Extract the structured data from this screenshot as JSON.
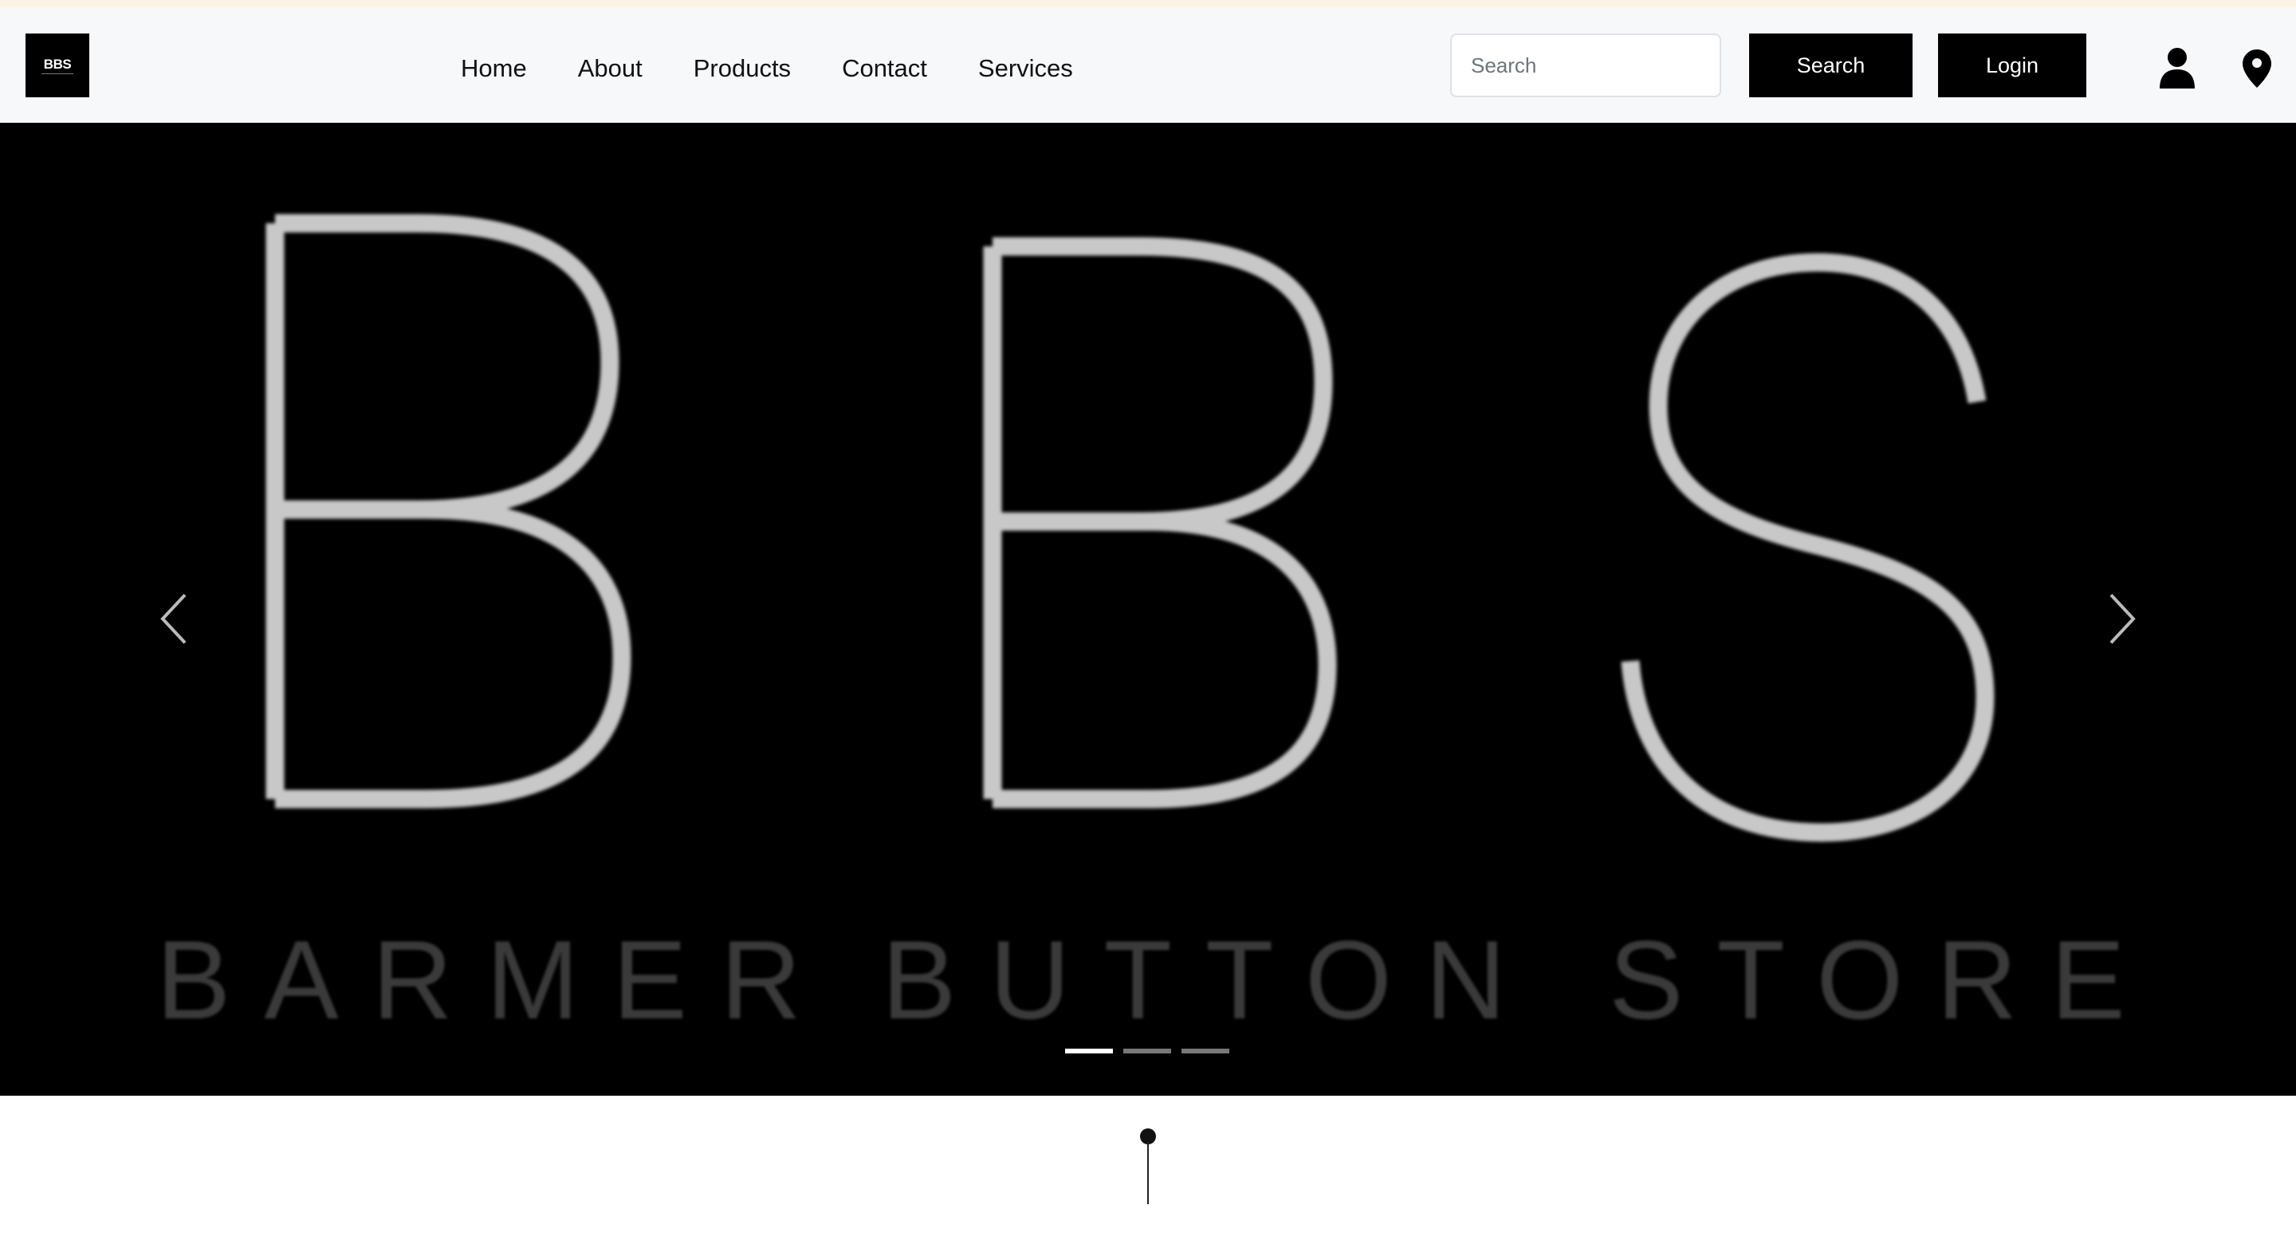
{
  "brand": {
    "logo_text": "BBS"
  },
  "nav": {
    "links": [
      {
        "label": "Home"
      },
      {
        "label": "About"
      },
      {
        "label": "Products"
      },
      {
        "label": "Contact"
      },
      {
        "label": "Services"
      }
    ]
  },
  "search": {
    "placeholder": "Search",
    "value": "",
    "button_label": "Search"
  },
  "auth": {
    "login_label": "Login"
  },
  "icons": {
    "user": "user-icon",
    "location": "map-pin-icon",
    "prev": "chevron-left-icon",
    "next": "chevron-right-icon"
  },
  "hero": {
    "logo_letters": "BBS",
    "words": [
      "BARMER",
      "BUTTON",
      "STORE"
    ],
    "active_slide": 1,
    "slide_count": 3
  },
  "colors": {
    "navbar_bg": "#f6f8fa",
    "accent_line": "#fbf3e6",
    "button_bg": "#000000",
    "hero_bg": "#000000",
    "hero_letter": "#c8c8c8",
    "hero_word": "#3a3a3a"
  }
}
